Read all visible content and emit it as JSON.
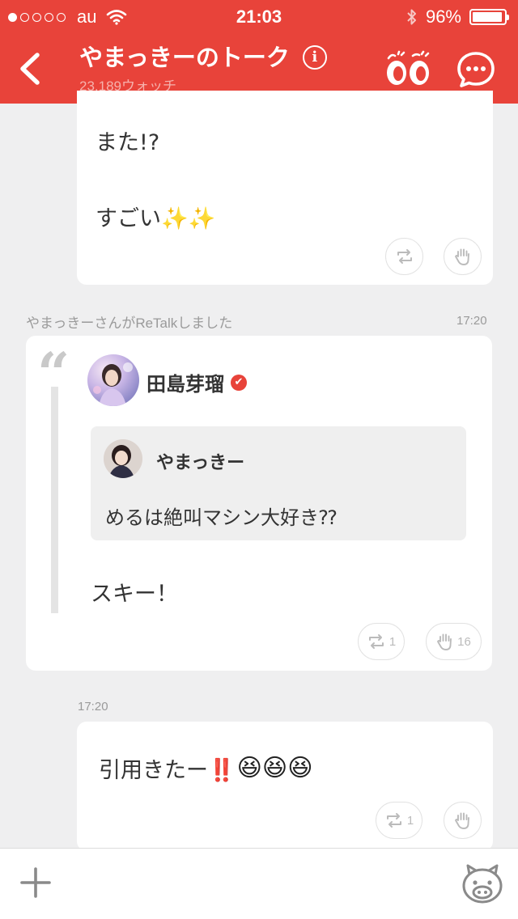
{
  "status_bar": {
    "carrier": "au",
    "time": "21:03",
    "battery": "96%",
    "battery_level": 0.96
  },
  "header": {
    "title": "やまっきーのトーク",
    "subtitle": "23,189ウォッチ",
    "info_glyph": "i"
  },
  "messages": [
    {
      "lines": [
        "また!?",
        "すごい✨✨"
      ]
    },
    {
      "retalk_notice": "やまっきーさんがReTalkしました",
      "time": "17:20",
      "quote_glyph": "“",
      "author": "田島芽瑠",
      "verified_glyph": "✔",
      "quoted_author": "やまっきー",
      "quoted_text": "めるは絶叫マシン大好き⁇",
      "reply_text": "スキー！",
      "retalk_count": "1",
      "like_count": "16"
    },
    {
      "time": "17:20",
      "text": "引用きたー‼️",
      "emojis": [
        "😆",
        "😆",
        "😆"
      ],
      "retalk_count": "1"
    }
  ],
  "colors": {
    "accent": "#e8433a",
    "background": "#efeff0"
  },
  "icons": [
    "back-arrow-icon",
    "info-icon",
    "watch-eyes-icon",
    "chat-bubble-icon",
    "retalk-icon",
    "hand-icon",
    "plus-icon",
    "mascot-icon",
    "wifi-icon",
    "bluetooth-icon"
  ]
}
